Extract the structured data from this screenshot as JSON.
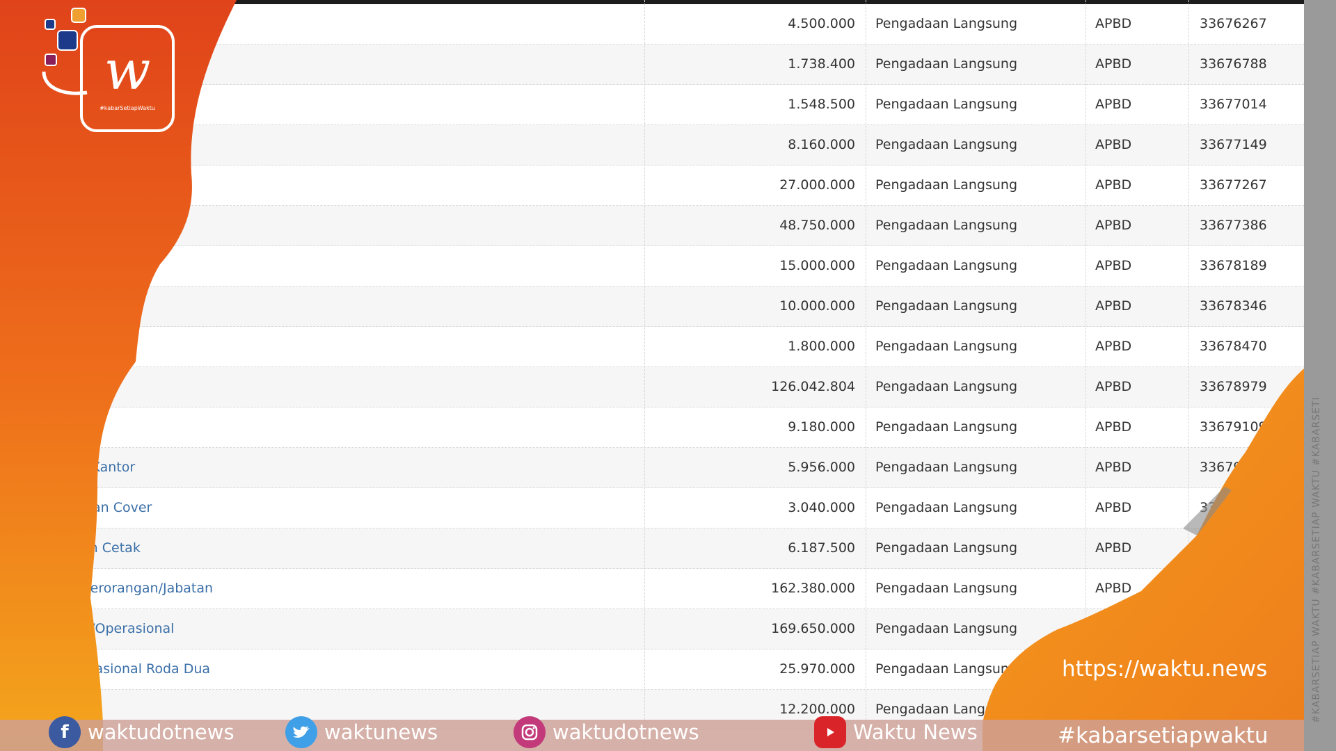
{
  "table": {
    "rows": [
      {
        "name": "",
        "amount": "4.500.000",
        "method": "Pengadaan Langsung",
        "fund": "APBD",
        "code": "33676267"
      },
      {
        "name": "",
        "amount": "1.738.400",
        "method": "Pengadaan Langsung",
        "fund": "APBD",
        "code": "33676788"
      },
      {
        "name": "",
        "amount": "1.548.500",
        "method": "Pengadaan Langsung",
        "fund": "APBD",
        "code": "33677014"
      },
      {
        "name": "",
        "amount": "8.160.000",
        "method": "Pengadaan Langsung",
        "fund": "APBD",
        "code": "33677149"
      },
      {
        "name": "",
        "amount": "27.000.000",
        "method": "Pengadaan Langsung",
        "fund": "APBD",
        "code": "33677267"
      },
      {
        "name": "",
        "amount": "48.750.000",
        "method": "Pengadaan Langsung",
        "fund": "APBD",
        "code": "33677386"
      },
      {
        "name": "",
        "amount": "15.000.000",
        "method": "Pengadaan Langsung",
        "fund": "APBD",
        "code": "33678189"
      },
      {
        "name": "",
        "amount": "10.000.000",
        "method": "Pengadaan Langsung",
        "fund": "APBD",
        "code": "33678346"
      },
      {
        "name": "",
        "amount": "1.800.000",
        "method": "Pengadaan Langsung",
        "fund": "APBD",
        "code": "33678470"
      },
      {
        "name": "",
        "amount": "126.042.804",
        "method": "Pengadaan Langsung",
        "fund": "APBD",
        "code": "33678979"
      },
      {
        "name": "",
        "amount": "9.180.000",
        "method": "Pengadaan Langsung",
        "fund": "APBD",
        "code": "33679109"
      },
      {
        "name": "lis Kantor",
        "amount": "5.956.000",
        "method": "Pengadaan Langsung",
        "fund": "APBD",
        "code": "3367921"
      },
      {
        "name": "s dan Cover",
        "amount": "3.040.000",
        "method": "Pengadaan Langsung",
        "fund": "APBD",
        "code": "336"
      },
      {
        "name": "han Cetak",
        "amount": "6.187.500",
        "method": "Pengadaan Langsung",
        "fund": "APBD",
        "code": ""
      },
      {
        "name": "r Perorangan/Jabatan",
        "amount": "162.380.000",
        "method": "Pengadaan Langsung",
        "fund": "APBD",
        "code": ""
      },
      {
        "name": "at /Operasional",
        "amount": "169.650.000",
        "method": "Pengadaan Langsung",
        "fund": "",
        "code": ""
      },
      {
        "name": "perasional Roda Dua",
        "amount": "25.970.000",
        "method": "Pengadaan Langsun",
        "fund": "",
        "code": ""
      },
      {
        "name": "",
        "amount": "12.200.000",
        "method": "Pengadaan Langs",
        "fund": "",
        "code": ""
      }
    ]
  },
  "watermark": {
    "url": "https://waktu.news",
    "hashtag": "#kabarsetiapwaktu",
    "vertical_text": "#KABARSETIAP WAKTU #KABARSETIAP WAKTU #KABARSETI",
    "logo_text": "#kabarSetiapWaktu"
  },
  "social": [
    {
      "icon": "facebook-icon",
      "handle": "waktudotnews"
    },
    {
      "icon": "twitter-icon",
      "handle": "waktunews"
    },
    {
      "icon": "instagram-icon",
      "handle": "waktudotnews"
    },
    {
      "icon": "youtube-icon",
      "handle": "Waktu News"
    }
  ],
  "colors": {
    "orange_dark": "#e2491a",
    "orange_mid": "#f07a1c",
    "orange_light": "#f7a21c",
    "link_blue": "#3a6fa8",
    "footer": "#cda096"
  }
}
